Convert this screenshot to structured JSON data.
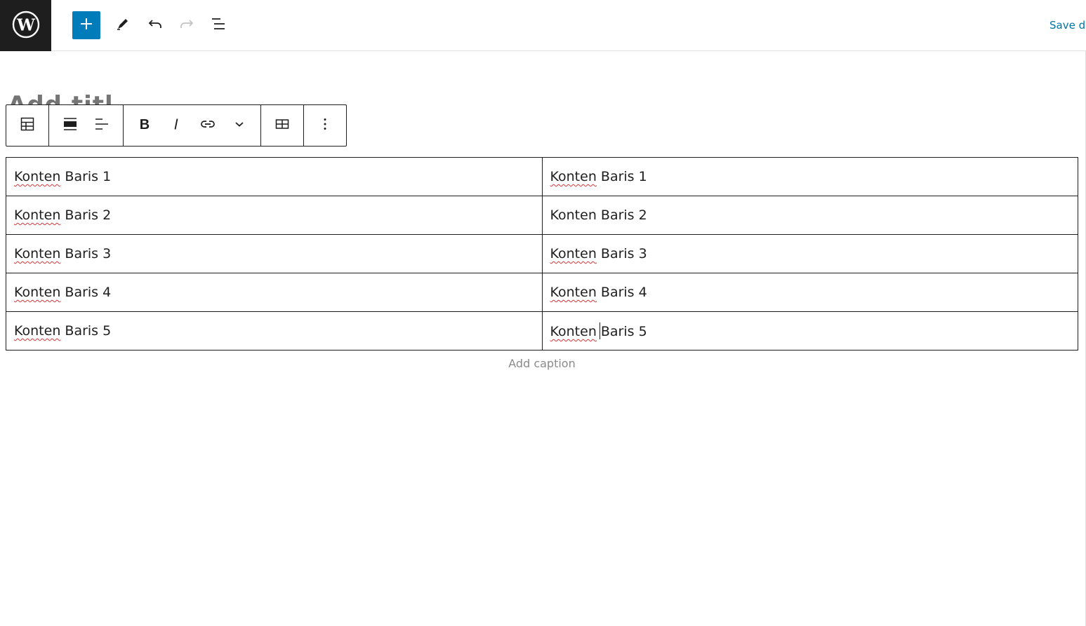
{
  "header": {
    "logo_icon": "wordpress-logo-icon",
    "add_block_icon": "plus-icon",
    "tools_icon": "pencil-icon",
    "undo_icon": "undo-icon",
    "redo_icon": "redo-icon",
    "outline_icon": "list-view-icon",
    "save_label": "Save dr",
    "accent_color": "#007cba"
  },
  "post": {
    "title_placeholder_fragment": "Add titl"
  },
  "block_toolbar": {
    "icons": [
      "table-icon",
      "align-full-width-icon",
      "align-left-icon",
      "bold-icon",
      "italic-icon",
      "link-icon",
      "chevron-down-icon",
      "edit-table-icon",
      "more-options-icon"
    ]
  },
  "table": {
    "rows": [
      {
        "c1_a": "Konten",
        "c1_b": " Baris 1",
        "c2_a": "Konten",
        "c2_b": " Baris 1"
      },
      {
        "c1_a": "Konten",
        "c1_b": " Baris 2",
        "c2_a": "Konten",
        "c2_b": " Baris 2"
      },
      {
        "c1_a": "Konten",
        "c1_b": " Baris 3",
        "c2_a": "Konten",
        "c2_b": " Baris 3"
      },
      {
        "c1_a": "Konten",
        "c1_b": " Baris 4",
        "c2_a": "Konten",
        "c2_b": " Baris 4"
      },
      {
        "c1_a": "Konten",
        "c1_b": " Baris 5",
        "c2_a": "Konten",
        "c2_b": "Baris 5"
      }
    ],
    "caption_placeholder": "Add caption"
  }
}
